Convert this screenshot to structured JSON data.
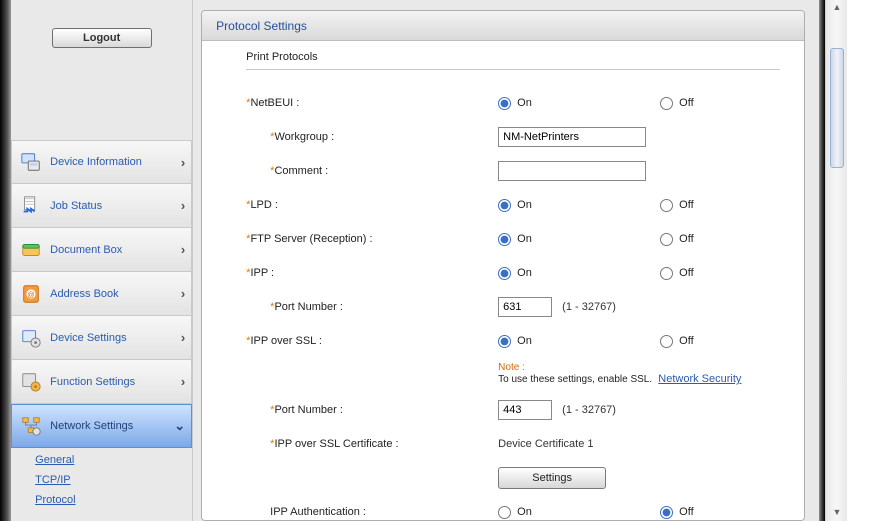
{
  "logout_label": "Logout",
  "sidebar": {
    "items": [
      {
        "label": "Device Information"
      },
      {
        "label": "Job Status"
      },
      {
        "label": "Document Box"
      },
      {
        "label": "Address Book"
      },
      {
        "label": "Device Settings"
      },
      {
        "label": "Function Settings"
      },
      {
        "label": "Network Settings"
      }
    ],
    "sub_links": [
      {
        "label": "General"
      },
      {
        "label": "TCP/IP"
      },
      {
        "label": "Protocol"
      }
    ]
  },
  "card": {
    "title": "Protocol Settings",
    "section": "Print Protocols",
    "rows": {
      "netbeui": {
        "label": "NetBEUI :",
        "on": "On",
        "off": "Off",
        "value": "on"
      },
      "workgroup": {
        "label": "Workgroup :",
        "value": "NM-NetPrinters"
      },
      "comment": {
        "label": "Comment :",
        "value": ""
      },
      "lpd": {
        "label": "LPD :",
        "on": "On",
        "off": "Off",
        "value": "on"
      },
      "ftp": {
        "label": "FTP Server (Reception) :",
        "on": "On",
        "off": "Off",
        "value": "on"
      },
      "ipp": {
        "label": "IPP :",
        "on": "On",
        "off": "Off",
        "value": "on"
      },
      "ipp_port": {
        "label": "Port Number :",
        "value": "631",
        "hint": "(1 - 32767)"
      },
      "ipp_ssl": {
        "label": "IPP over SSL :",
        "on": "On",
        "off": "Off",
        "value": "on"
      },
      "note": {
        "title": "Note :",
        "text": "To use these settings, enable SSL.",
        "link": "Network Security"
      },
      "ipp_ssl_port": {
        "label": "Port Number :",
        "value": "443",
        "hint": "(1 - 32767)"
      },
      "ipp_ssl_cert": {
        "label": "IPP over SSL Certificate :",
        "value": "Device Certificate 1"
      },
      "settings_button": "Settings",
      "ipp_auth": {
        "label": "IPP Authentication :",
        "on": "On",
        "off": "Off",
        "value": "off"
      }
    }
  }
}
